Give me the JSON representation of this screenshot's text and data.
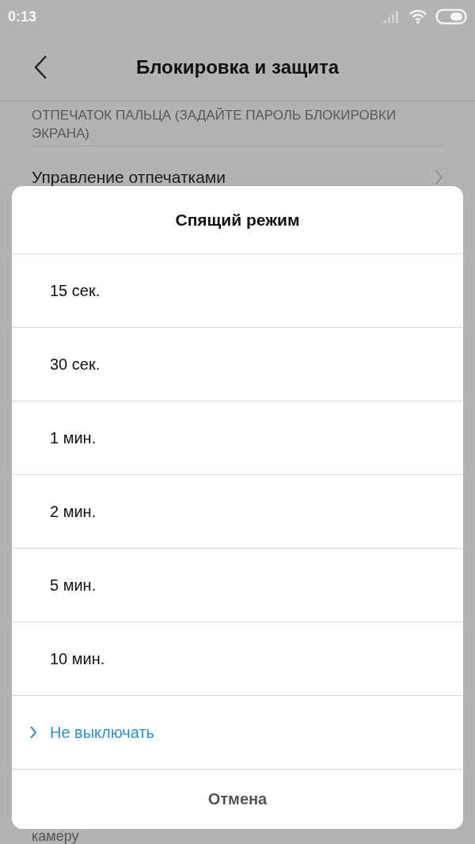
{
  "status_bar": {
    "time": "0:13"
  },
  "header": {
    "title": "Блокировка и защита"
  },
  "section": {
    "heading": "ОТПЕЧАТОК ПАЛЬЦА (ЗАДАЙТЕ ПАРОЛЬ БЛОКИРОВКИ ЭКРАНА)"
  },
  "settings_items": [
    {
      "label": "Управление отпечатками"
    }
  ],
  "background_text": "камеру",
  "dialog": {
    "title": "Спящий режим",
    "options": [
      {
        "label": "15 сек.",
        "selected": false
      },
      {
        "label": "30 сек.",
        "selected": false
      },
      {
        "label": "1 мин.",
        "selected": false
      },
      {
        "label": "2 мин.",
        "selected": false
      },
      {
        "label": "5 мин.",
        "selected": false
      },
      {
        "label": "10 мин.",
        "selected": false
      },
      {
        "label": "Не выключать",
        "selected": true
      }
    ],
    "cancel": "Отмена"
  }
}
